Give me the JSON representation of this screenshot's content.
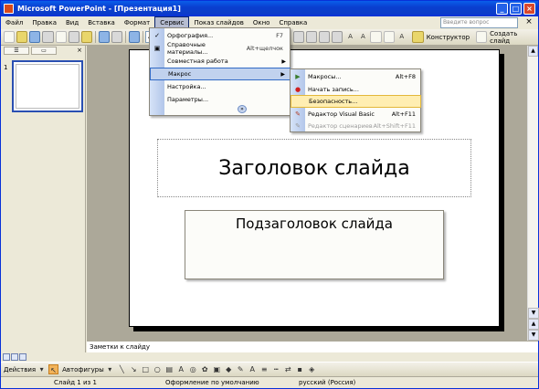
{
  "titlebar": {
    "title": "Microsoft PowerPoint - [Презентация1]",
    "buttons": [
      "_",
      "□",
      "×"
    ]
  },
  "menubar": {
    "items": [
      "Файл",
      "Правка",
      "Вид",
      "Вставка",
      "Формат",
      "Сервис",
      "Показ слайдов",
      "Окно",
      "Справка"
    ],
    "ask_placeholder": "Введите вопрос",
    "close_glyph": "×"
  },
  "toolbar": {
    "font": "Arial",
    "bold": "A",
    "design_label": "Конструктор",
    "new_slide_label": "Создать слайд"
  },
  "left_pane": {
    "slide_number": "1",
    "close_glyph": "×"
  },
  "slide": {
    "title_placeholder": "Заголовок слайда",
    "subtitle_placeholder": "Подзаголовок слайда"
  },
  "notes_placeholder": "Заметки к слайду",
  "drawbar": {
    "actions": "Действия",
    "autoshapes": "Автофигуры"
  },
  "statusbar": {
    "slide": "Слайд 1 из 1",
    "design": "Оформление по умолчанию",
    "language": "русский (Россия)"
  },
  "service_menu": {
    "items": [
      {
        "label": "Орфография...",
        "shortcut": "F7",
        "icon": "spellcheck-icon",
        "submenu": false
      },
      {
        "label": "Справочные материалы...",
        "shortcut": "Alt+щелчок",
        "icon": "research-icon",
        "submenu": false
      },
      {
        "label": "Совместная работа",
        "shortcut": "",
        "icon": "",
        "submenu": true
      },
      {
        "label": "Макрос",
        "shortcut": "",
        "icon": "",
        "submenu": true
      },
      {
        "label": "Настройка...",
        "shortcut": "",
        "icon": "",
        "submenu": false
      },
      {
        "label": "Параметры...",
        "shortcut": "",
        "icon": "",
        "submenu": false
      }
    ],
    "more_glyph": "»"
  },
  "macro_submenu": {
    "items": [
      {
        "label": "Макросы...",
        "shortcut": "Alt+F8",
        "icon": "play-icon",
        "disabled": false
      },
      {
        "label": "Начать запись...",
        "shortcut": "",
        "icon": "record-icon",
        "disabled": false
      },
      {
        "label": "Безопасность...",
        "shortcut": "",
        "icon": "",
        "disabled": false
      },
      {
        "label": "Редактор Visual Basic",
        "shortcut": "Alt+F11",
        "icon": "vb-editor-icon",
        "disabled": false
      },
      {
        "label": "Редактор сценариев",
        "shortcut": "Alt+Shift+F11",
        "icon": "script-editor-icon",
        "disabled": true
      }
    ]
  },
  "colors": {
    "titlebar": "#0a3fd0",
    "highlight": "#c1d2ee",
    "sub_highlight": "#ffeeb2",
    "canvas": "#aca899"
  }
}
